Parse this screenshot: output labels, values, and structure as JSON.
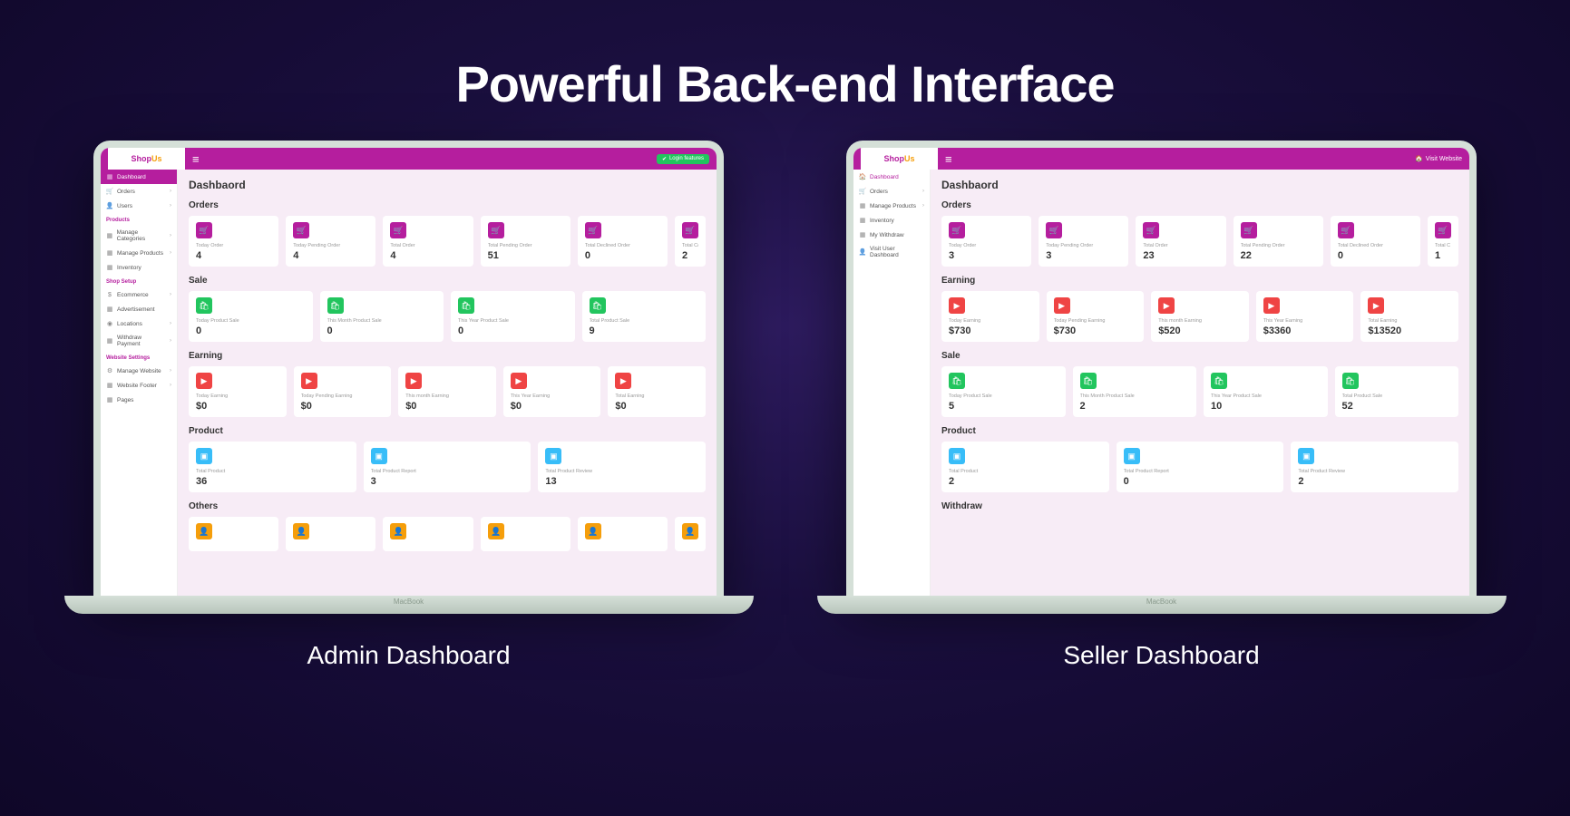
{
  "hero": "Powerful Back-end Interface",
  "captions": {
    "admin": "Admin Dashboard",
    "seller": "Seller Dashboard"
  },
  "device": "MacBook",
  "logo": {
    "a": "Shop",
    "b": "Us"
  },
  "topbar": {
    "login_pill": "Login features",
    "visit": "Visit Website"
  },
  "page_title": "Dashbaord",
  "admin": {
    "sidebar": {
      "items": [
        {
          "icon": "▦",
          "label": "Dashboard",
          "active": true
        },
        {
          "icon": "🛒",
          "label": "Orders",
          "chev": true
        },
        {
          "icon": "👤",
          "label": "Users",
          "chev": true
        }
      ],
      "groups": [
        {
          "header": "Products",
          "items": [
            {
              "icon": "▦",
              "label": "Manage Categories",
              "chev": true
            },
            {
              "icon": "▦",
              "label": "Manage Products",
              "chev": true
            },
            {
              "icon": "▦",
              "label": "Inventory"
            }
          ]
        },
        {
          "header": "Shop Setup",
          "items": [
            {
              "icon": "$",
              "label": "Ecommerce",
              "chev": true
            },
            {
              "icon": "▦",
              "label": "Advertisement"
            },
            {
              "icon": "◉",
              "label": "Locations",
              "chev": true
            },
            {
              "icon": "▦",
              "label": "Withdraw Payment",
              "chev": true
            }
          ]
        },
        {
          "header": "Website Settings",
          "items": [
            {
              "icon": "⚙",
              "label": "Manage Website",
              "chev": true
            },
            {
              "icon": "▦",
              "label": "Website Footer",
              "chev": true
            },
            {
              "icon": "▦",
              "label": "Pages"
            }
          ]
        }
      ]
    },
    "sections": [
      {
        "title": "Orders",
        "color": "purple",
        "glyph": "🛒",
        "cards": [
          {
            "label": "Today Order",
            "value": "4"
          },
          {
            "label": "Today Pending Order",
            "value": "4"
          },
          {
            "label": "Total Order",
            "value": "4"
          },
          {
            "label": "Total Pending Order",
            "value": "51"
          },
          {
            "label": "Total Declined Order",
            "value": "0"
          },
          {
            "label": "Total Complete",
            "value": "2",
            "narrow": true
          }
        ]
      },
      {
        "title": "Sale",
        "color": "green",
        "glyph": "🛍",
        "cards": [
          {
            "label": "Today Product Sale",
            "value": "0"
          },
          {
            "label": "This Month Product Sale",
            "value": "0"
          },
          {
            "label": "This Year Product Sale",
            "value": "0"
          },
          {
            "label": "Total Product Sale",
            "value": "9"
          }
        ]
      },
      {
        "title": "Earning",
        "color": "red",
        "glyph": "▶",
        "cards": [
          {
            "label": "Today Earning",
            "value": "$0"
          },
          {
            "label": "Today Pending Earning",
            "value": "$0"
          },
          {
            "label": "This month Earning",
            "value": "$0"
          },
          {
            "label": "This Year Earning",
            "value": "$0"
          },
          {
            "label": "Total Earning",
            "value": "$0"
          }
        ]
      },
      {
        "title": "Product",
        "color": "blue",
        "glyph": "▣",
        "cards": [
          {
            "label": "Total Product",
            "value": "36"
          },
          {
            "label": "Total Product Report",
            "value": "3"
          },
          {
            "label": "Total Product Review",
            "value": "13"
          }
        ]
      },
      {
        "title": "Others",
        "color": "orange",
        "glyph": "👤",
        "cards": [
          {
            "label": "",
            "value": ""
          },
          {
            "label": "",
            "value": ""
          },
          {
            "label": "",
            "value": ""
          },
          {
            "label": "",
            "value": ""
          },
          {
            "label": "",
            "value": ""
          },
          {
            "label": "",
            "value": "",
            "narrow": true
          }
        ]
      }
    ]
  },
  "seller": {
    "sidebar": {
      "items": [
        {
          "icon": "🏠",
          "label": "Dashboard",
          "active": false,
          "pinkText": true
        },
        {
          "icon": "🛒",
          "label": "Orders",
          "chev": true
        },
        {
          "icon": "▦",
          "label": "Manage Products",
          "chev": true
        },
        {
          "icon": "▦",
          "label": "Inventory"
        },
        {
          "icon": "▦",
          "label": "My Withdraw"
        },
        {
          "icon": "👤",
          "label": "Visit User Dashboard"
        }
      ],
      "groups": []
    },
    "sections": [
      {
        "title": "Orders",
        "color": "purple",
        "glyph": "🛒",
        "cards": [
          {
            "label": "Today Order",
            "value": "3"
          },
          {
            "label": "Today Pending Order",
            "value": "3"
          },
          {
            "label": "Total Order",
            "value": "23"
          },
          {
            "label": "Total Pending Order",
            "value": "22"
          },
          {
            "label": "Total Declined Order",
            "value": "0"
          },
          {
            "label": "Total C",
            "value": "1",
            "narrow": true
          }
        ]
      },
      {
        "title": "Earning",
        "color": "red",
        "glyph": "▶",
        "cards": [
          {
            "label": "Today Earning",
            "value": "$730"
          },
          {
            "label": "Today Pending Earning",
            "value": "$730"
          },
          {
            "label": "This month Earning",
            "value": "$520"
          },
          {
            "label": "This Year Earning",
            "value": "$3360"
          },
          {
            "label": "Total Earning",
            "value": "$13520"
          }
        ]
      },
      {
        "title": "Sale",
        "color": "green",
        "glyph": "🛍",
        "cards": [
          {
            "label": "Today Product Sale",
            "value": "5"
          },
          {
            "label": "This Month Product Sale",
            "value": "2"
          },
          {
            "label": "This Year Product Sale",
            "value": "10"
          },
          {
            "label": "Total Product Sale",
            "value": "52"
          }
        ]
      },
      {
        "title": "Product",
        "color": "blue",
        "glyph": "▣",
        "cards": [
          {
            "label": "Total Product",
            "value": "2"
          },
          {
            "label": "Total Product Report",
            "value": "0"
          },
          {
            "label": "Total Product Review",
            "value": "2"
          }
        ]
      },
      {
        "title": "Withdraw",
        "color": "orange",
        "glyph": "$",
        "cards": []
      }
    ]
  }
}
